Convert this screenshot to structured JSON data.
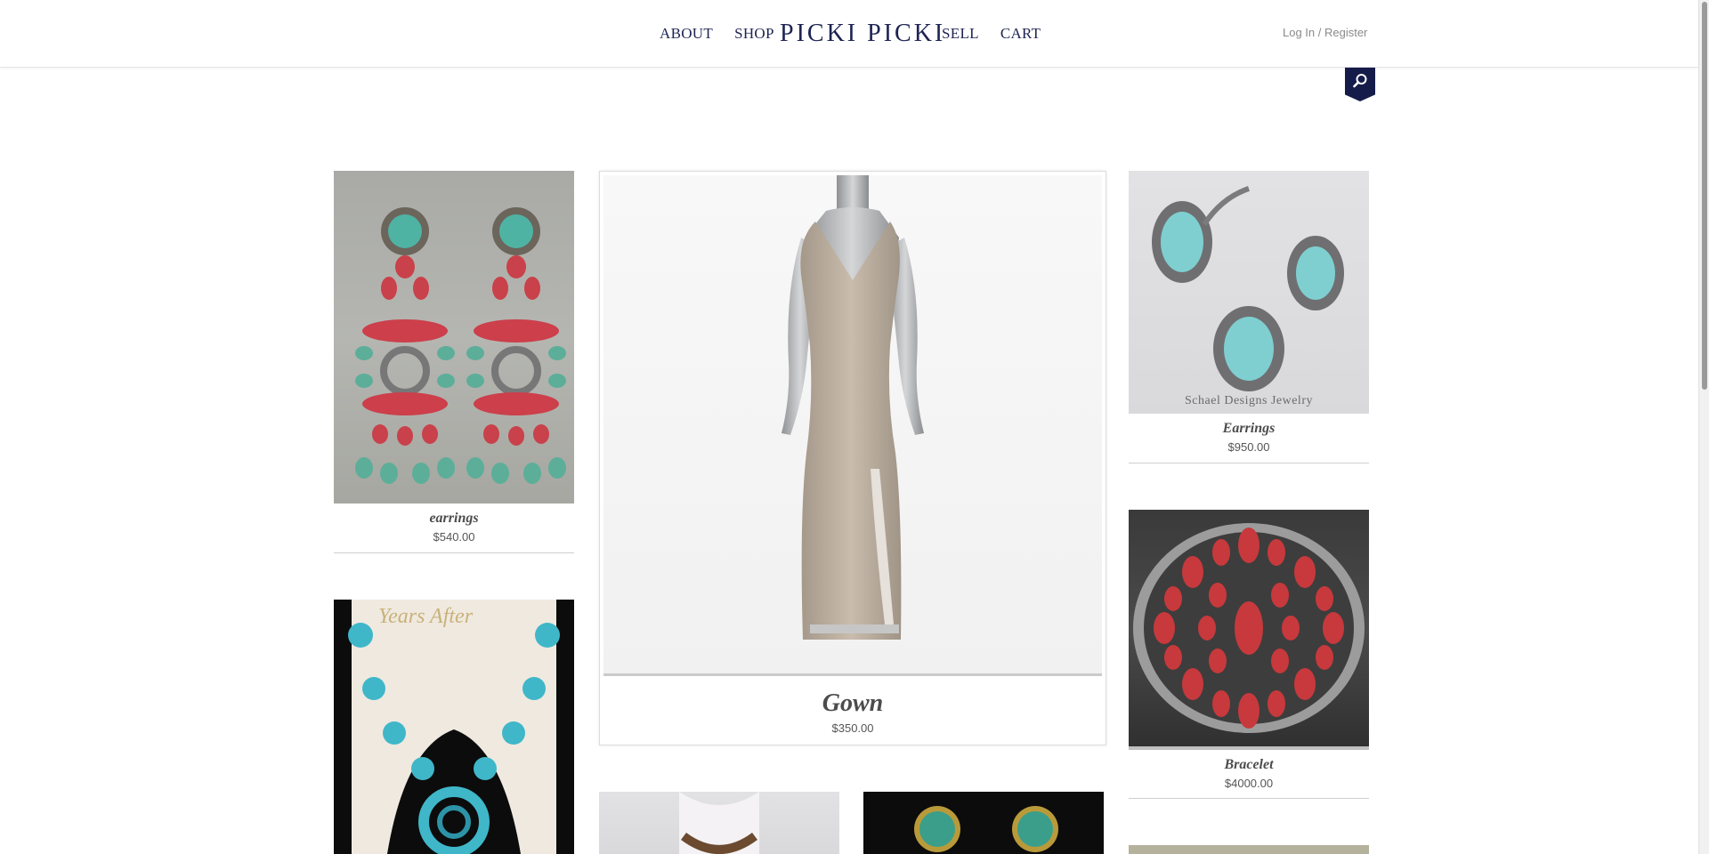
{
  "nav": {
    "about": "ABOUT",
    "shop": "SHOP",
    "brand": "PICKI PICKI",
    "sell": "SELL",
    "cart": "CART",
    "login": "Log In / Register"
  },
  "colors": {
    "brand_navy": "#1d2452",
    "search_tab": "#161c4a",
    "turquoise": "#3fb7c9",
    "coral": "#c7393c"
  },
  "icons": {
    "search": "search-icon"
  },
  "products": [
    {
      "title": "earrings",
      "price": "$540.00"
    },
    {
      "title": "Gown",
      "price": "$350.00"
    },
    {
      "title": "Earrings",
      "price": "$950.00",
      "watermark": "Schael Designs Jewelry"
    },
    {
      "title": "Bracelet",
      "price": "$4000.00"
    },
    {
      "title": "",
      "price": "",
      "watermark": "Years After"
    },
    {
      "title": "",
      "price": ""
    },
    {
      "title": "",
      "price": ""
    },
    {
      "title": "",
      "price": ""
    }
  ]
}
